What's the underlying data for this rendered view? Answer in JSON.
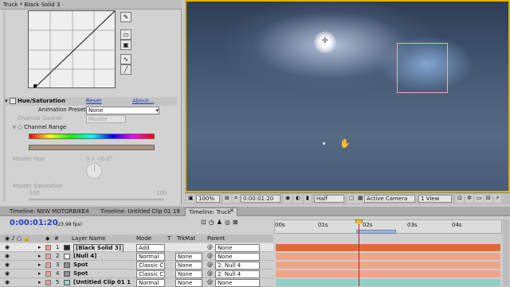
{
  "effect_panel": {
    "tab_title": "Truck * Black Solid 3",
    "section_title": "Hue/Saturation",
    "reset": "Reset",
    "about": "About...",
    "presets_label": "Animation Presets:",
    "presets_value": "None",
    "channel_control_label": "Channel Control",
    "channel_control_value": "Master",
    "channel_range_label": "Channel Range",
    "master_hue_label": "Master Hue",
    "master_hue_value": "0 x +0.0°",
    "master_saturation_label": "Master Saturation",
    "sat_min": "-100",
    "sat_max": "100"
  },
  "viewer": {
    "zoom": "100%",
    "timecode": "0:00:01:20",
    "resolution": "Half",
    "camera": "Active Camera",
    "views": "1 View"
  },
  "timeline": {
    "tabs": [
      "Timeline: NEW MOTORBIKE4",
      "Timeline: Untitled Clip 01 19",
      "Timeline: Truck"
    ],
    "current_time": "0:00:01:20",
    "fps": "(23.98 fps)",
    "ruler": [
      "00s",
      "01s",
      "02s",
      "03s",
      "04s"
    ],
    "columns": {
      "num": "#",
      "name": "Layer Name",
      "mode": "Mode",
      "t": "T",
      "trkmat": "TrkMat",
      "parent": "Parent"
    },
    "layers": [
      {
        "num": "1",
        "name": "[Black Solid 3]",
        "mode": "Add",
        "trkmat": "",
        "parent": "None",
        "color": "#2a2a2a",
        "bar": "#e06a3a"
      },
      {
        "num": "2",
        "name": "[Null 4]",
        "mode": "Normal",
        "trkmat": "None",
        "parent": "None",
        "color": "#ffffff",
        "bar": "#f0a48a"
      },
      {
        "num": "3",
        "name": "Spot",
        "mode": "Classic C",
        "trkmat": "None",
        "parent": "2. Null 4",
        "color": "#8f8f8f",
        "bar": "#f0a48a"
      },
      {
        "num": "4",
        "name": "Spot",
        "mode": "Classic C",
        "trkmat": "None",
        "parent": "2. Null 4",
        "color": "#8f8f8f",
        "bar": "#f0a48a"
      },
      {
        "num": "5",
        "name": "[Untitled Clip 01 1",
        "mode": "Normal",
        "trkmat": "None",
        "parent": "None",
        "color": "#9fd0cc",
        "bar": "#8fcfc5"
      }
    ]
  },
  "colors": {
    "accent": "#e0b000",
    "playhead": "#d01818"
  }
}
